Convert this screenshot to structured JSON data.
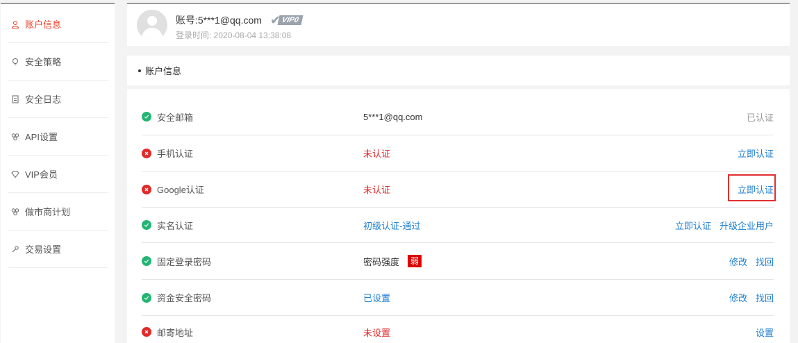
{
  "sidebar": {
    "items": [
      {
        "label": "账户信息",
        "icon": "user-icon",
        "active": true
      },
      {
        "label": "安全策略",
        "icon": "lightbulb-icon",
        "active": false
      },
      {
        "label": "安全日志",
        "icon": "document-icon",
        "active": false
      },
      {
        "label": "API设置",
        "icon": "api-icon",
        "active": false
      },
      {
        "label": "VIP会员",
        "icon": "diamond-icon",
        "active": false
      },
      {
        "label": "做市商计划",
        "icon": "market-maker-icon",
        "active": false
      },
      {
        "label": "交易设置",
        "icon": "wrench-icon",
        "active": false
      }
    ]
  },
  "header": {
    "account_prefix": "账号: ",
    "account": "5***1@qq.com",
    "vip_label": "VIP0",
    "login_time": "登录时间: 2020-08-04 13:38:08"
  },
  "section": {
    "title": "账户信息"
  },
  "rows": [
    {
      "label": "安全邮箱",
      "status": "ok",
      "value": "5***1@qq.com",
      "value_color": "dark",
      "actions": [],
      "done_text": "已认证"
    },
    {
      "label": "手机认证",
      "status": "bad",
      "value": "未认证",
      "value_color": "red",
      "actions": [
        "立即认证"
      ]
    },
    {
      "label": "Google认证",
      "status": "bad",
      "value": "未认证",
      "value_color": "red",
      "actions": [
        "立即认证"
      ]
    },
    {
      "label": "实名认证",
      "status": "ok",
      "value": "初级认证-通过",
      "value_color": "blue",
      "actions": [
        "立即认证",
        "升级企业用户"
      ]
    },
    {
      "label": "固定登录密码",
      "status": "ok",
      "value": "密码强度",
      "value_color": "dark",
      "badge": "弱",
      "actions": [
        "修改",
        "找回"
      ]
    },
    {
      "label": "资金安全密码",
      "status": "ok",
      "value": "已设置",
      "value_color": "blue",
      "actions": [
        "修改",
        "找回"
      ]
    },
    {
      "label": "邮寄地址",
      "status": "bad",
      "value": "未设置",
      "value_color": "red",
      "actions": [
        "设置"
      ]
    }
  ],
  "colors": {
    "accent": "#e6422a",
    "link": "#1f7fd0",
    "ok": "#22b573",
    "bad": "#e02a2a"
  }
}
